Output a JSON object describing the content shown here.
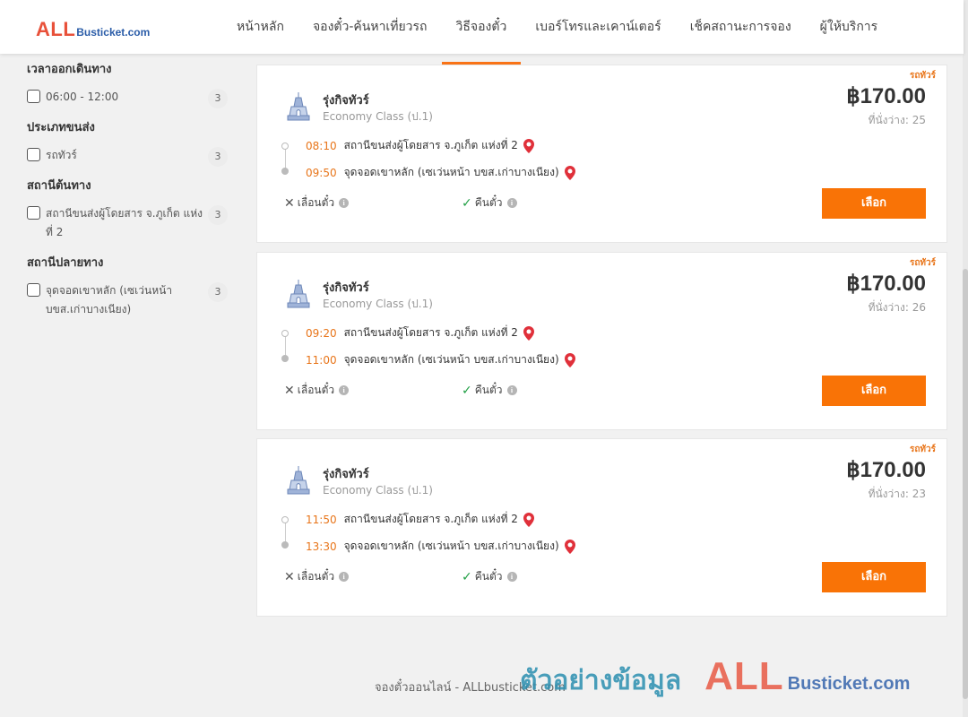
{
  "brand": {
    "logo_all": "ALL",
    "logo_rest": "Busticket.com"
  },
  "nav": {
    "items": [
      {
        "label": "หน้าหลัก"
      },
      {
        "label": "จองตั๋ว-ค้นหาเที่ยวรถ"
      },
      {
        "label": "วิธีจองตั๋ว"
      },
      {
        "label": "เบอร์โทรและเคาน์เตอร์"
      },
      {
        "label": "เช็คสถานะการจอง"
      },
      {
        "label": "ผู้ให้บริการ"
      }
    ],
    "active_index": 2
  },
  "filters": {
    "departure_time": {
      "title": "เวลาออกเดินทาง",
      "option": "06:00 - 12:00",
      "count": "3"
    },
    "transport_type": {
      "title": "ประเภทขนส่ง",
      "option": "รถทัวร์",
      "count": "3"
    },
    "origin": {
      "title": "สถานีต้นทาง",
      "option": "สถานีขนส่งผู้โดยสาร จ.ภูเก็ต แห่งที่ 2",
      "count": "3"
    },
    "destination": {
      "title": "สถานีปลายทาง",
      "option": "จุดจอดเขาหลัก (เซเว่นหน้า บขส.เก่าบางเนียง)",
      "count": "3"
    }
  },
  "trips": [
    {
      "type_badge": "รถทัวร์",
      "operator": "รุ่งกิจทัวร์",
      "bus_class": "Economy Class (ป.1)",
      "price": "฿170.00",
      "seats": "ที่นั่งว่าง: 25",
      "dep_time": "08:10",
      "dep_place": "สถานีขนส่งผู้โดยสาร จ.ภูเก็ต แห่งที่ 2",
      "arr_time": "09:50",
      "arr_place": "จุดจอดเขาหลัก (เซเว่นหน้า บขส.เก่าบางเนียง)",
      "change_label": "เลื่อนตั๋ว",
      "refund_label": "คืนตั๋ว",
      "select_label": "เลือก"
    },
    {
      "type_badge": "รถทัวร์",
      "operator": "รุ่งกิจทัวร์",
      "bus_class": "Economy Class (ป.1)",
      "price": "฿170.00",
      "seats": "ที่นั่งว่าง: 26",
      "dep_time": "09:20",
      "dep_place": "สถานีขนส่งผู้โดยสาร จ.ภูเก็ต แห่งที่ 2",
      "arr_time": "11:00",
      "arr_place": "จุดจอดเขาหลัก (เซเว่นหน้า บขส.เก่าบางเนียง)",
      "change_label": "เลื่อนตั๋ว",
      "refund_label": "คืนตั๋ว",
      "select_label": "เลือก"
    },
    {
      "type_badge": "รถทัวร์",
      "operator": "รุ่งกิจทัวร์",
      "bus_class": "Economy Class (ป.1)",
      "price": "฿170.00",
      "seats": "ที่นั่งว่าง: 23",
      "dep_time": "11:50",
      "dep_place": "สถานีขนส่งผู้โดยสาร จ.ภูเก็ต แห่งที่ 2",
      "arr_time": "13:30",
      "arr_place": "จุดจอดเขาหลัก (เซเว่นหน้า บขส.เก่าบางเนียง)",
      "change_label": "เลื่อนตั๋ว",
      "refund_label": "คืนตั๋ว",
      "select_label": "เลือก"
    }
  ],
  "footer": {
    "text": "จองตั๋วออนไลน์ - ALLbusticket.com"
  },
  "watermark": {
    "thai": "ตัวอย่างข้อมูล",
    "all": "ALL",
    "rest": "Busticket.com"
  },
  "colors": {
    "accent": "#f97306",
    "time": "#e8751a",
    "logo_red": "#e8513a",
    "logo_blue": "#2a5ca8"
  }
}
